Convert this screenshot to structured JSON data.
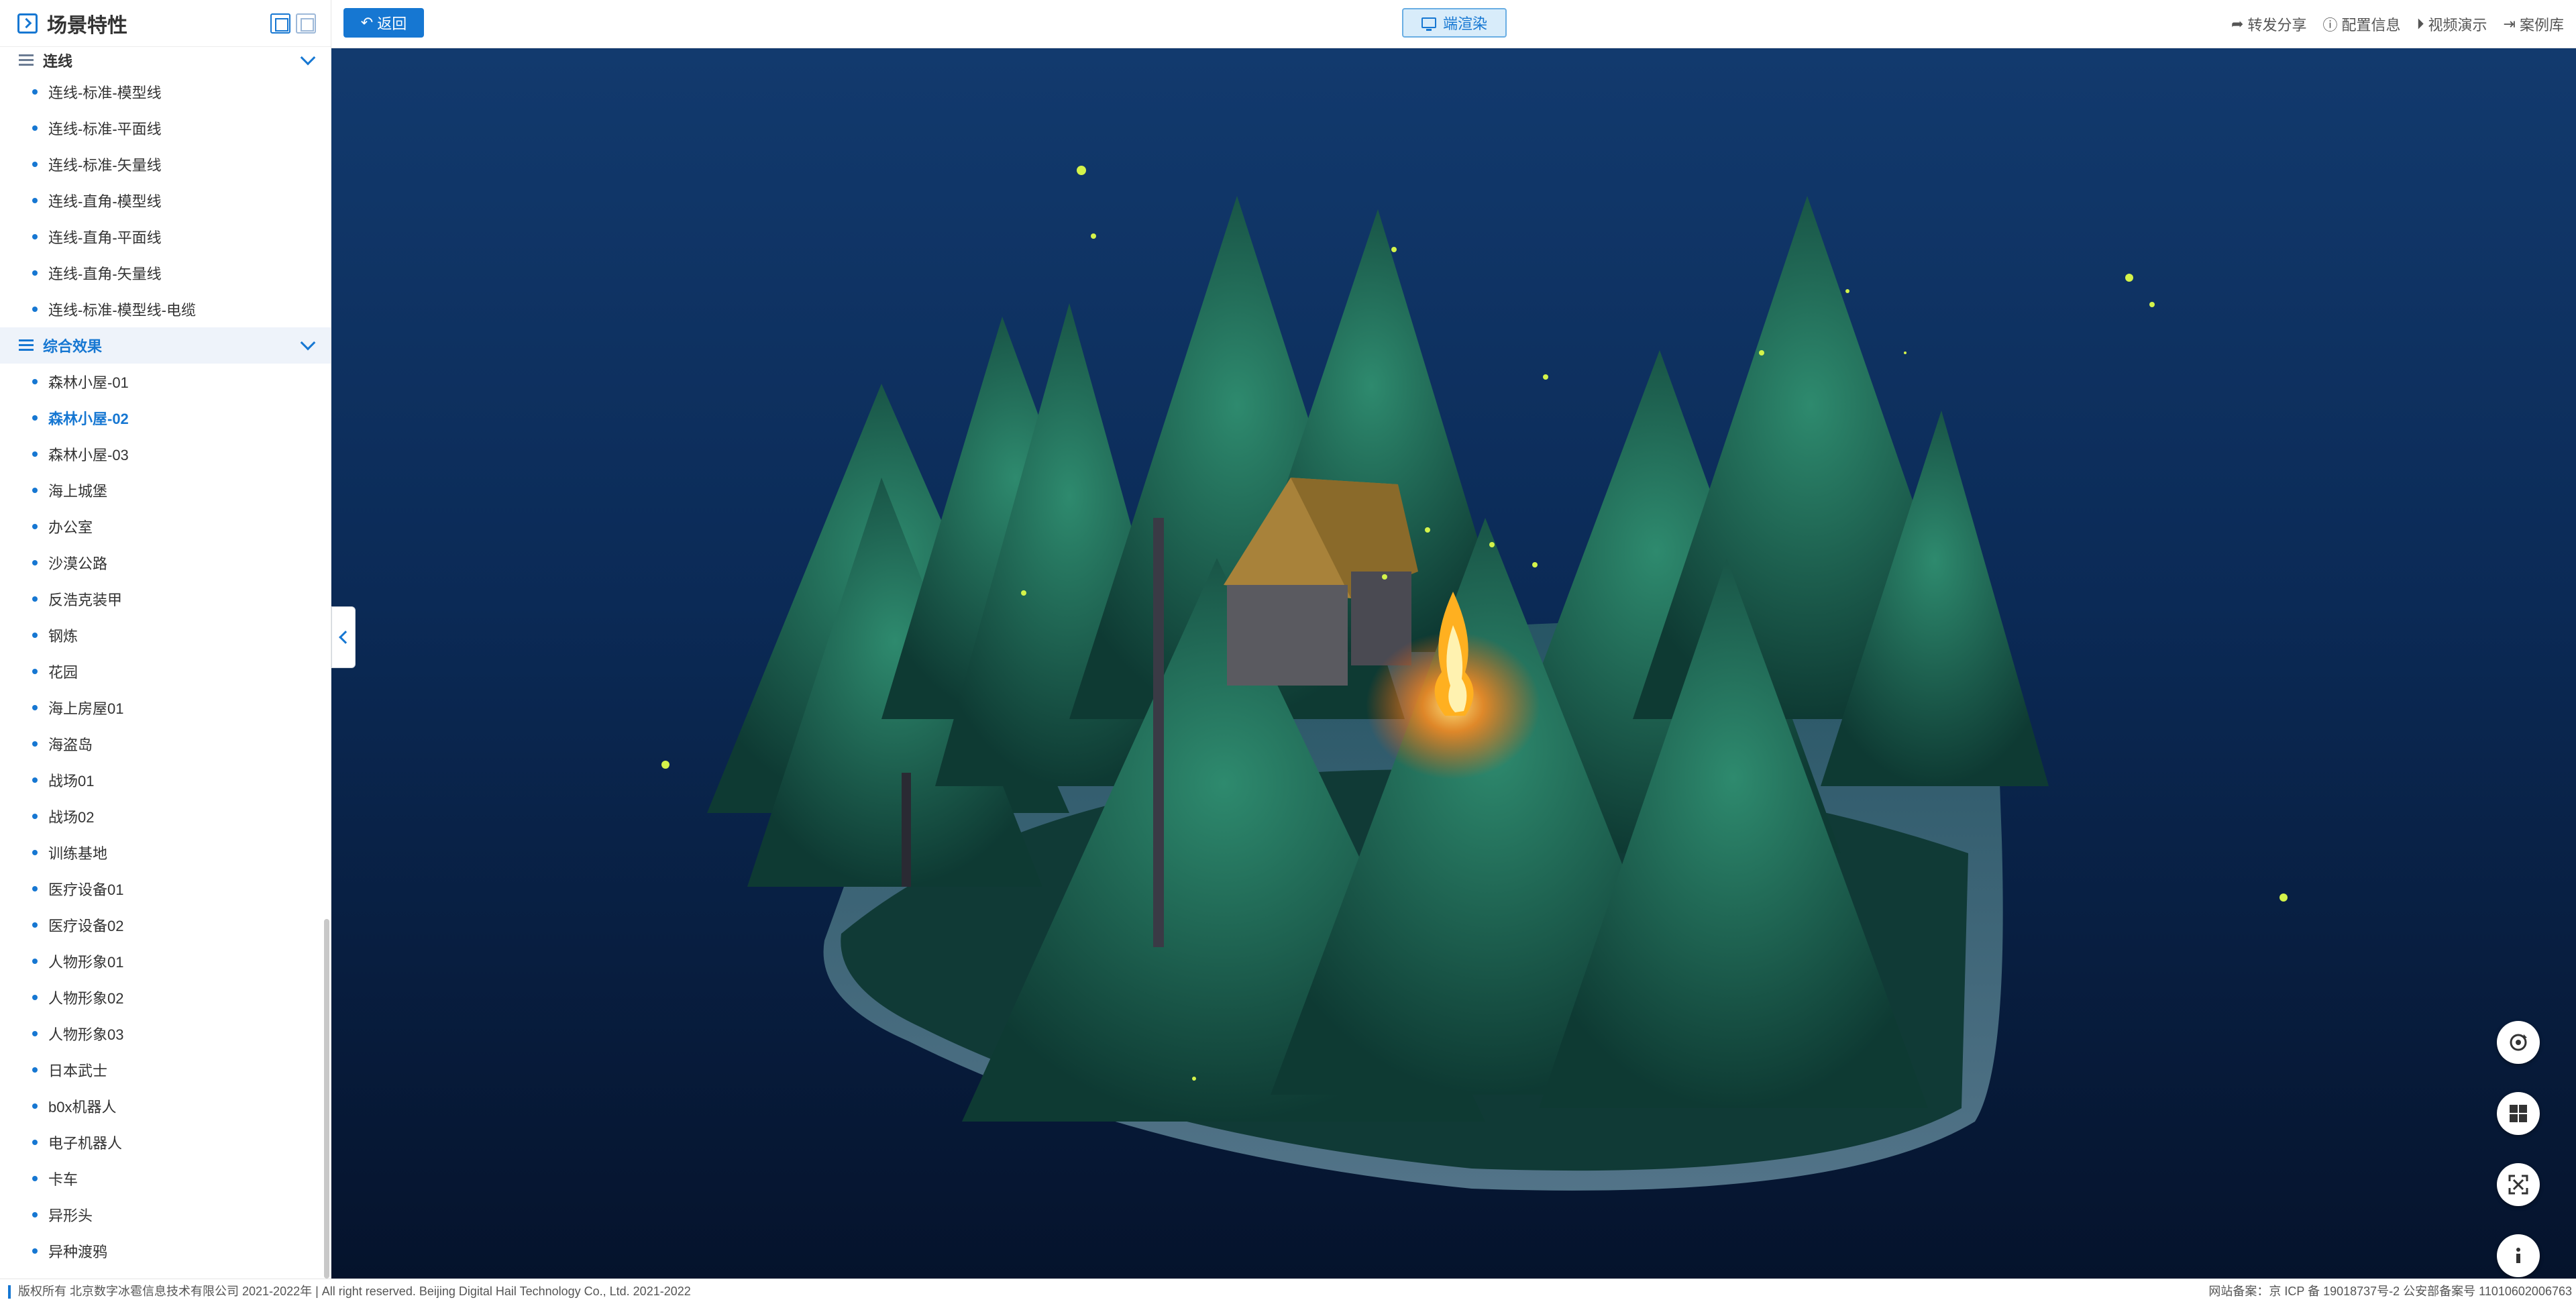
{
  "sidebar": {
    "title": "场景特性",
    "groups": [
      {
        "label": "连线",
        "items": [
          "连线-标准-模型线",
          "连线-标准-平面线",
          "连线-标准-矢量线",
          "连线-直角-模型线",
          "连线-直角-平面线",
          "连线-直角-矢量线",
          "连线-标准-模型线-电缆"
        ]
      },
      {
        "label": "综合效果",
        "selected": "森林小屋-02",
        "items": [
          "森林小屋-01",
          "森林小屋-02",
          "森林小屋-03",
          "海上城堡",
          "办公室",
          "沙漠公路",
          "反浩克装甲",
          "钢炼",
          "花园",
          "海上房屋01",
          "海盗岛",
          "战场01",
          "战场02",
          "训练基地",
          "医疗设备01",
          "医疗设备02",
          "人物形象01",
          "人物形象02",
          "人物形象03",
          "日本武士",
          "b0x机器人",
          "电子机器人",
          "卡车",
          "异形头",
          "异种渡鸦"
        ]
      }
    ]
  },
  "topbar": {
    "back_label": "返回",
    "render_label": "端渲染",
    "actions": [
      {
        "label": "转发分享",
        "icon": "share-icon"
      },
      {
        "label": "配置信息",
        "icon": "info-icon"
      },
      {
        "label": "视频演示",
        "icon": "play-icon"
      },
      {
        "label": "案例库",
        "icon": "exit-icon"
      }
    ]
  },
  "footer": {
    "copyright": "版权所有 北京数字冰雹信息技术有限公司 2021-2022年 | All right reserved. Beijing Digital Hail Technology Co., Ltd. 2021-2022",
    "icp": "网站备案：京 ICP 备 19018737号-2 公安部备案号 11010602006763"
  },
  "colors": {
    "accent": "#1677d2",
    "viewport_top": "#123a6e",
    "viewport_bottom": "#05132c"
  }
}
